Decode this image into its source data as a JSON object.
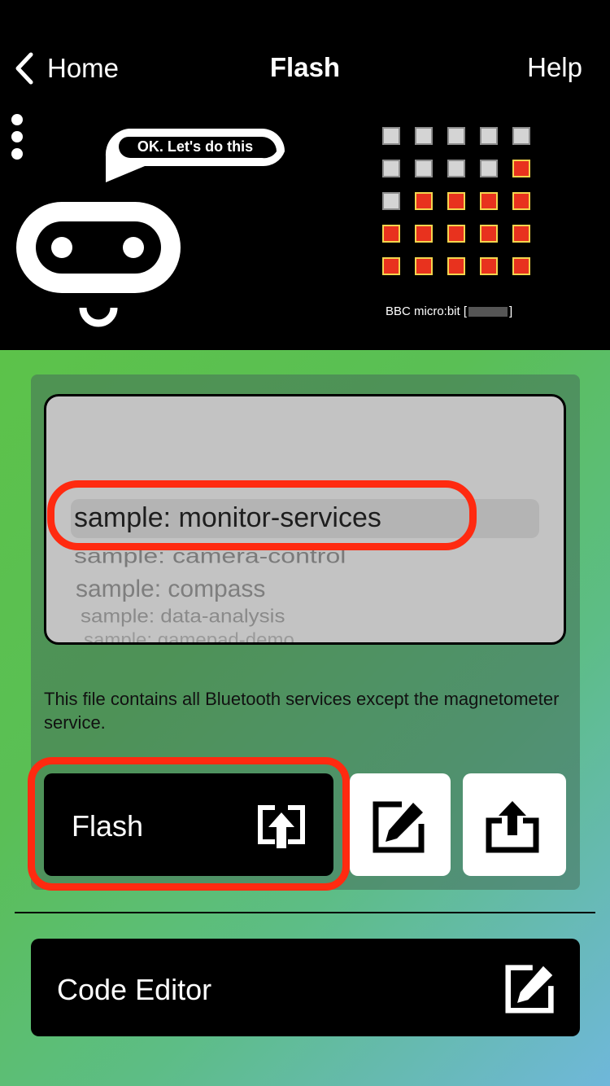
{
  "nav": {
    "back_label": "Home",
    "title": "Flash",
    "help_label": "Help"
  },
  "robot": {
    "speech": "OK. Let's do this"
  },
  "device": {
    "label_prefix": "BBC micro:bit [",
    "label_suffix": "]",
    "led_states": [
      [
        0,
        0,
        0,
        0,
        0
      ],
      [
        0,
        0,
        0,
        0,
        1
      ],
      [
        0,
        1,
        1,
        1,
        1
      ],
      [
        1,
        1,
        1,
        1,
        1
      ],
      [
        1,
        1,
        1,
        1,
        1
      ]
    ],
    "colors": {
      "led_on": "#e8321e",
      "led_on_border": "#f3d54e",
      "led_off": "#d4d4d4"
    }
  },
  "picker": {
    "items": [
      "sample: monitor-services",
      "sample: camera-control",
      "sample: compass",
      "sample: data-analysis",
      "sample: gamepad-demo"
    ]
  },
  "description": "This file contains all Bluetooth services except the magnetometer service.",
  "buttons": {
    "flash_label": "Flash",
    "code_editor_label": "Code Editor"
  },
  "colors": {
    "highlight": "#ff2a10",
    "gradient_start": "#5cc24a",
    "gradient_end": "#6fb7da"
  }
}
